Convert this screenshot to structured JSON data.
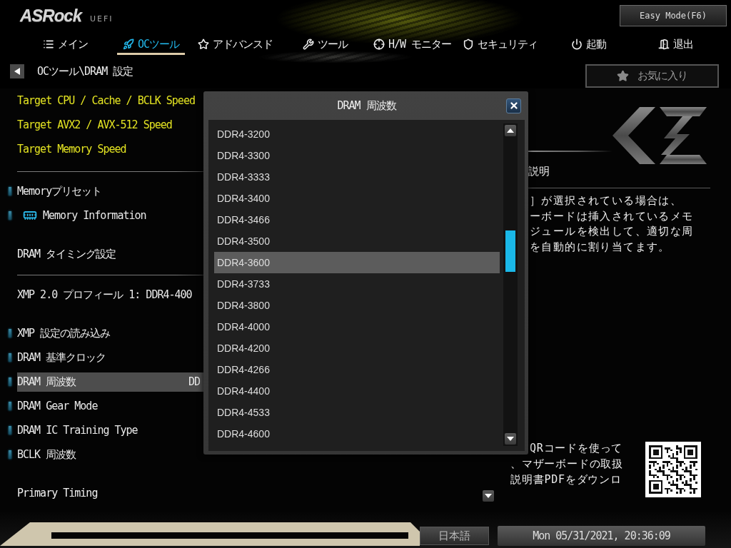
{
  "logo": {
    "brand": "ASRock",
    "product": "UEFI"
  },
  "mode_button": "Easy Mode(F6)",
  "tabs": [
    {
      "label": "メイン",
      "selected": false
    },
    {
      "label": "OCツール",
      "selected": true
    },
    {
      "label": "アドバンスド",
      "selected": false
    },
    {
      "label": "ツール",
      "selected": false
    },
    {
      "label": "H/W モニター",
      "selected": false
    },
    {
      "label": "セキュリティ",
      "selected": false
    },
    {
      "label": "起動",
      "selected": false
    },
    {
      "label": "退出",
      "selected": false
    }
  ],
  "breadcrumb": "OCツール\\DRAM 設定",
  "favorites_button": "お気に入り",
  "settings_groups": [
    {
      "rows": [
        {
          "kind": "target",
          "label": "Target CPU / Cache / BCLK Speed",
          "selected": false
        },
        {
          "kind": "target",
          "label": "Target AVX2 / AVX-512 Speed",
          "selected": false
        },
        {
          "kind": "target",
          "label": "Target Memory Speed",
          "selected": false
        }
      ]
    },
    {
      "rows": [
        {
          "kind": "option",
          "label": "Memoryプリセット",
          "selected": false
        },
        {
          "kind": "link",
          "label": "Memory Information",
          "selected": false
        },
        {
          "kind": "heading",
          "label": "DRAM タイミング設定",
          "selected": false
        }
      ]
    },
    {
      "rows": [
        {
          "kind": "info",
          "label": "XMP 2.0 プロフィール 1: DDR4-400",
          "selected": false
        },
        {
          "kind": "option",
          "label": "XMP 設定の読み込み",
          "selected": false
        },
        {
          "kind": "option",
          "label": "DRAM 基準クロック",
          "selected": false
        },
        {
          "kind": "option",
          "label": "DRAM 周波数",
          "selected": true,
          "value": "DD"
        },
        {
          "kind": "option",
          "label": "DRAM Gear Mode",
          "selected": false
        },
        {
          "kind": "option",
          "label": "DRAM IC Training Type",
          "selected": false
        },
        {
          "kind": "option",
          "label": "BCLK 周波数",
          "selected": false
        },
        {
          "kind": "heading",
          "label": "Primary Timing",
          "selected": false
        }
      ]
    }
  ],
  "dialog": {
    "title": "DRAM 周波数",
    "options": [
      {
        "label": "DDR4-3200",
        "selected": false
      },
      {
        "label": "DDR4-3300",
        "selected": false
      },
      {
        "label": "DDR4-3333",
        "selected": false
      },
      {
        "label": "DDR4-3400",
        "selected": false
      },
      {
        "label": "DDR4-3466",
        "selected": false
      },
      {
        "label": "DDR4-3500",
        "selected": false
      },
      {
        "label": "DDR4-3600",
        "selected": true
      },
      {
        "label": "DDR4-3733",
        "selected": false
      },
      {
        "label": "DDR4-3800",
        "selected": false
      },
      {
        "label": "DDR4-4000",
        "selected": false
      },
      {
        "label": "DDR4-4200",
        "selected": false
      },
      {
        "label": "DDR4-4266",
        "selected": false
      },
      {
        "label": "DDR4-4400",
        "selected": false
      },
      {
        "label": "DDR4-4533",
        "selected": false
      },
      {
        "label": "DDR4-4600",
        "selected": false
      }
    ]
  },
  "description": {
    "heading": "説明",
    "lines": [
      "］が選択されている場合は、",
      "ーボードは挿入されているメモ",
      "ジュールを検出して、適切な周",
      "を自動的に割り当てます。"
    ]
  },
  "qr_help": {
    "lines": [
      "QRコードを使って",
      "、マザーボードの取扱",
      "説明書PDFをダウンロ"
    ]
  },
  "status_bar": {
    "language": "日本語",
    "datetime": "Mon 05/31/2021, 20:36:09"
  }
}
